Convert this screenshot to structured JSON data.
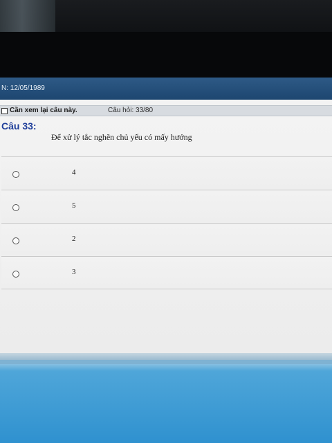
{
  "header": {
    "text": "N: 12/05/1989"
  },
  "review": {
    "label": "Cần xem lại câu này.",
    "question_count": "Câu hỏi: 33/80"
  },
  "question": {
    "number": "Câu 33:",
    "text": "Để xử lý tắc nghẽn chủ yếu có mấy hướng"
  },
  "answers": [
    {
      "label": "4"
    },
    {
      "label": "5"
    },
    {
      "label": "2"
    },
    {
      "label": "3"
    }
  ],
  "colors": {
    "header_bg": "#1d4670",
    "question_number": "#1f3e9a",
    "lower_pane": "#2f91cf"
  }
}
